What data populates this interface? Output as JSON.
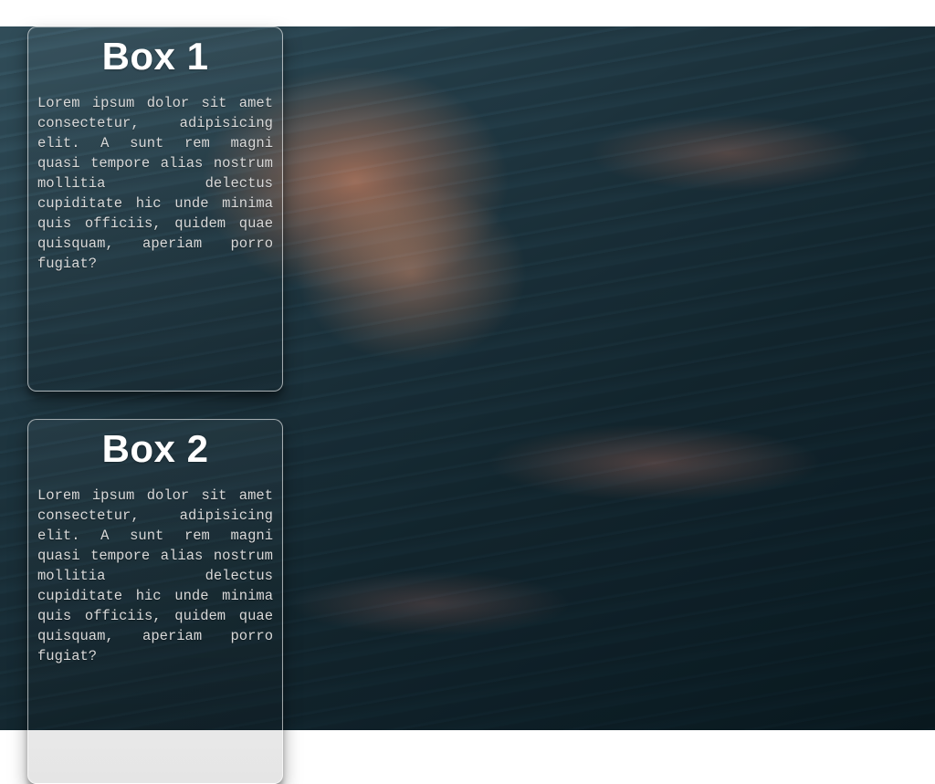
{
  "boxes": [
    {
      "title": "Box 1",
      "body": "Lorem ipsum dolor sit amet consectetur, adipisicing elit. A sunt rem magni quasi tempore alias nostrum mollitia delectus cupiditate hic unde minima quis officiis, quidem quae quisquam, aperiam porro fugiat?"
    },
    {
      "title": "Box 2",
      "body": "Lorem ipsum dolor sit amet consectetur, adipisicing elit. A sunt rem magni quasi tempore alias nostrum mollitia delectus cupiditate hic unde minima quis officiis, quidem quae quisquam, aperiam porro fugiat?"
    }
  ]
}
